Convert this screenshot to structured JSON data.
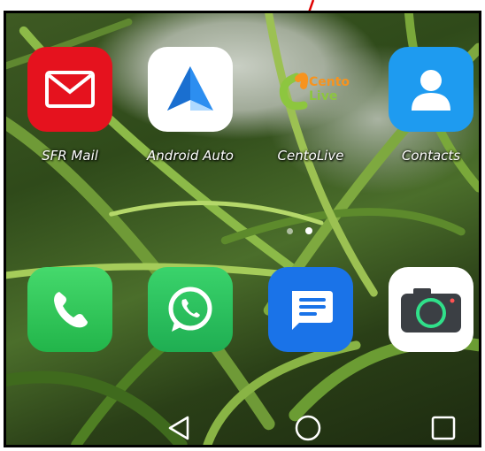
{
  "home_screen": {
    "apps_row1": [
      {
        "label": "SFR Mail",
        "icon": "mail-icon",
        "color": "#e5121e"
      },
      {
        "label": "Android Auto",
        "icon": "android-auto-icon",
        "color": "#ffffff"
      },
      {
        "label": "CentoLive",
        "icon": "centolive-logo-icon",
        "logo_text": "Cento Live"
      },
      {
        "label": "Contacts",
        "icon": "contact-person-icon",
        "color": "#1e9bf0"
      }
    ],
    "page_indicator": {
      "pages": 2,
      "active": 2
    },
    "dock": [
      {
        "icon": "phone-icon",
        "color": "#2ecc55"
      },
      {
        "icon": "whatsapp-icon",
        "color": "#22c05b"
      },
      {
        "icon": "messages-icon",
        "color": "#1a73e8"
      },
      {
        "icon": "camera-icon",
        "color": "#ffffff"
      }
    ],
    "navigation_bar": [
      "back-icon",
      "home-icon",
      "recents-icon"
    ],
    "annotation": {
      "icon": "red-arrow-icon",
      "color": "#e00000"
    }
  }
}
